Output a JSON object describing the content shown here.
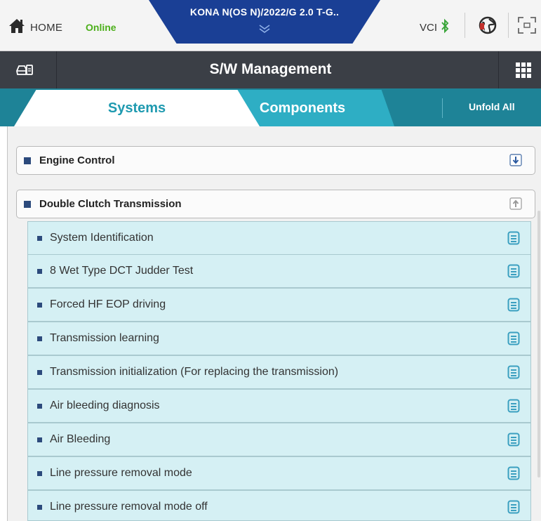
{
  "topbar": {
    "home_label": "HOME",
    "status_label": "Online",
    "vehicle_label": "KONA N(OS N)/2022/G 2.0 T-G..",
    "vci_label": "VCI",
    "colors": {
      "online": "#4caf1a",
      "vehicle_tab": "#1a3f95"
    }
  },
  "titlebar": {
    "title": "S/W Management"
  },
  "tabs": {
    "systems_label": "Systems",
    "components_label": "Components",
    "unfold_all_label": "Unfold All",
    "active": "Systems"
  },
  "groups": [
    {
      "label": "Engine Control",
      "expanded": false,
      "icon": "expand-arrow-icon"
    },
    {
      "label": "Double Clutch Transmission",
      "expanded": true,
      "icon": "collapse-arrow-icon"
    }
  ],
  "items": [
    {
      "label": "System Identification",
      "icon": "document-icon"
    },
    {
      "label": "8 Wet Type DCT Judder Test",
      "icon": "document-icon"
    },
    {
      "label": "Forced HF EOP driving",
      "icon": "document-icon"
    },
    {
      "label": "Transmission learning",
      "icon": "document-icon"
    },
    {
      "label": "Transmission initialization (For replacing the transmission)",
      "icon": "document-icon"
    },
    {
      "label": "Air bleeding diagnosis",
      "icon": "document-icon"
    },
    {
      "label": "Air Bleeding",
      "icon": "document-icon"
    },
    {
      "label": "Line pressure removal mode",
      "icon": "document-icon"
    },
    {
      "label": "Line pressure removal mode off",
      "icon": "document-icon"
    }
  ]
}
